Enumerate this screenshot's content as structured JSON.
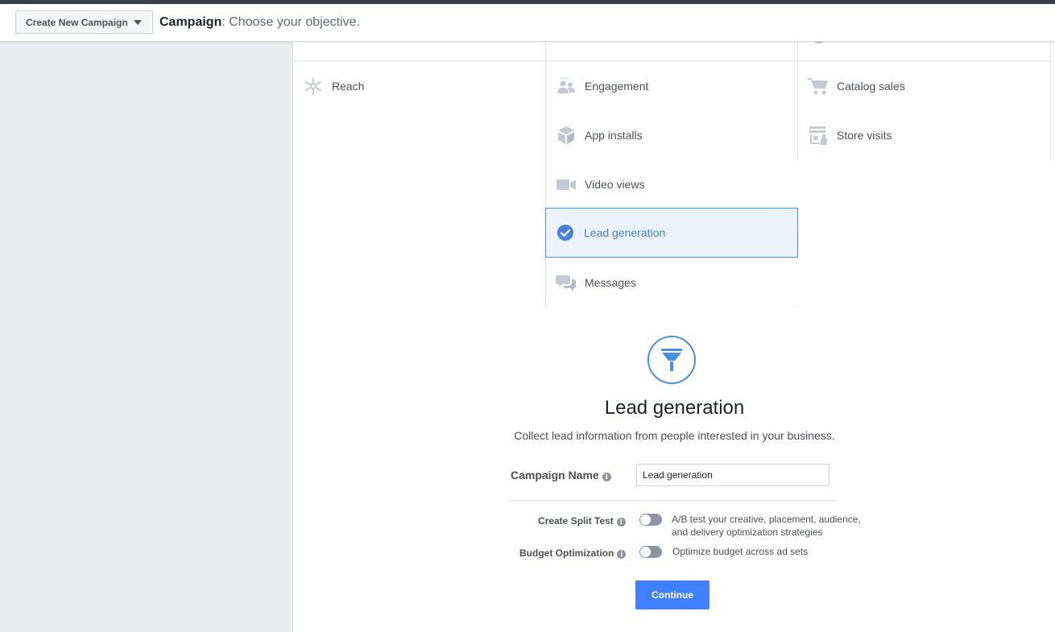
{
  "header": {
    "create_button_label": "Create New Campaign",
    "breadcrumb_section": "Campaign",
    "breadcrumb_text": ": Choose your objective."
  },
  "objectives": {
    "reach": "Reach",
    "engagement": "Engagement",
    "catalog_sales": "Catalog sales",
    "app_installs": "App installs",
    "store_visits": "Store visits",
    "video_views": "Video views",
    "lead_generation": "Lead generation",
    "messages": "Messages",
    "selected": "Lead generation"
  },
  "detail": {
    "title": "Lead generation",
    "description": "Collect lead information from people interested in your business.",
    "campaign_name_label": "Campaign Name",
    "campaign_name_value": "Lead generation",
    "split_test_label": "Create Split Test",
    "split_test_desc_line1": "A/B test your creative, placement, audience,",
    "split_test_desc_line2": "and delivery optimization strategies",
    "split_test_enabled": false,
    "budget_opt_label": "Budget Optimization",
    "budget_opt_desc": "Optimize budget across ad sets",
    "budget_opt_enabled": false,
    "continue_label": "Continue"
  },
  "colors": {
    "accent": "#4080ff",
    "selected_bg": "#eaf3fb",
    "selected_border": "#4a90e2",
    "icon_gray": "#c4c9d3"
  }
}
